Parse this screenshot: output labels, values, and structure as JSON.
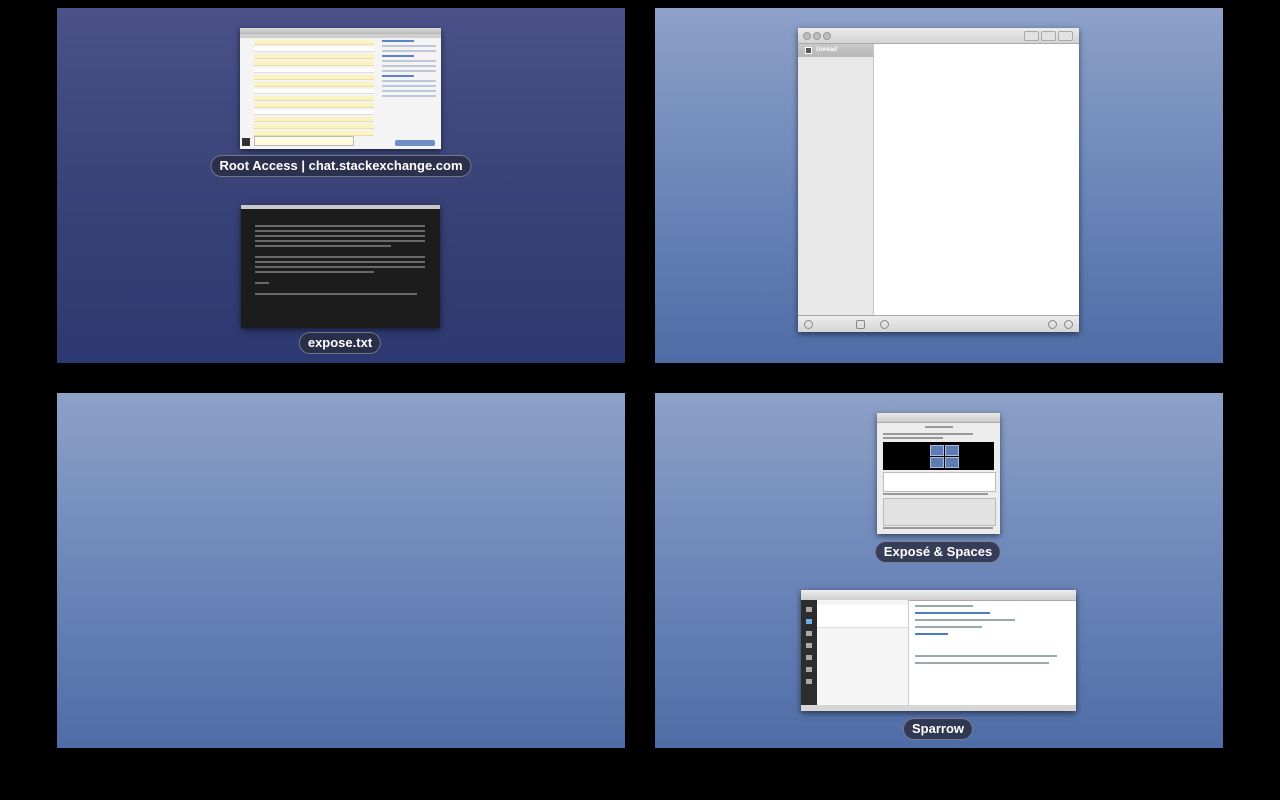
{
  "spaces": [
    {
      "id": 1,
      "windows": [
        {
          "label": "Root Access | chat.stackexchange.com"
        },
        {
          "label": "expose.txt"
        }
      ]
    },
    {
      "id": 2,
      "windows": [
        {
          "label": ""
        }
      ],
      "reader": {
        "sidebar_item": "Unread"
      }
    },
    {
      "id": 3,
      "windows": []
    },
    {
      "id": 4,
      "windows": [
        {
          "label": "Exposé & Spaces"
        },
        {
          "label": "Sparrow"
        }
      ]
    }
  ],
  "colors": {
    "background": "#000000",
    "space_top": "#8da1c8",
    "space_bottom": "#4f6ca6",
    "active_space_top": "#4a5289",
    "active_space_bottom": "#2c3870"
  }
}
